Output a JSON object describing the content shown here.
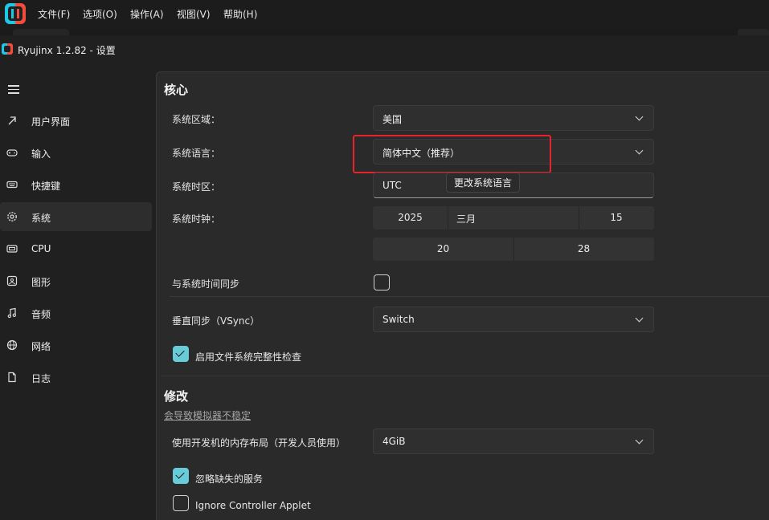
{
  "menubar": {
    "items": [
      "文件(F)",
      "选项(O)",
      "操作(A)",
      "视图(V)",
      "帮助(H)"
    ]
  },
  "window": {
    "title": "Ryujinx 1.2.82 - 设置"
  },
  "sidebar": {
    "items": [
      {
        "label": "用户界面",
        "icon": "ui-icon",
        "selected": false
      },
      {
        "label": "输入",
        "icon": "gamepad-icon",
        "selected": false
      },
      {
        "label": "快捷键",
        "icon": "keyboard-icon",
        "selected": false
      },
      {
        "label": "系统",
        "icon": "gear-icon",
        "selected": true
      },
      {
        "label": "CPU",
        "icon": "cpu-icon",
        "selected": false
      },
      {
        "label": "图形",
        "icon": "image-icon",
        "selected": false
      },
      {
        "label": "音频",
        "icon": "music-note-icon",
        "selected": false
      },
      {
        "label": "网络",
        "icon": "globe-icon",
        "selected": false
      },
      {
        "label": "日志",
        "icon": "document-icon",
        "selected": false
      }
    ]
  },
  "core": {
    "title": "核心",
    "region": {
      "label": "系统区域：",
      "value": "美国"
    },
    "language": {
      "label": "系统语言：",
      "value": "简体中文（推荐）",
      "tooltip": "更改系统语言"
    },
    "timezone": {
      "label": "系统时区：",
      "value": "UTC"
    },
    "clock": {
      "label": "系统时钟：",
      "year": "2025",
      "month": "三月",
      "day": "15",
      "hour": "20",
      "minute": "28"
    },
    "sync_time": {
      "label": "与系统时间同步",
      "checked": false
    },
    "vsync": {
      "label": "垂直同步（VSync）",
      "value": "Switch"
    },
    "fs_integrity": {
      "label": "启用文件系统完整性检查",
      "checked": true
    }
  },
  "hacks": {
    "title": "修改",
    "warning": "会导致模拟器不稳定",
    "memory_layout": {
      "label": "使用开发机的内存布局（开发人员使用）",
      "value": "4GiB"
    },
    "ignore_missing": {
      "label": "忽略缺失的服务",
      "checked": true
    },
    "ignore_applet": {
      "label": "Ignore Controller Applet",
      "checked": false
    }
  },
  "colors": {
    "accent": "#67cbd8",
    "highlight": "#e8242a",
    "background": "#202020"
  }
}
